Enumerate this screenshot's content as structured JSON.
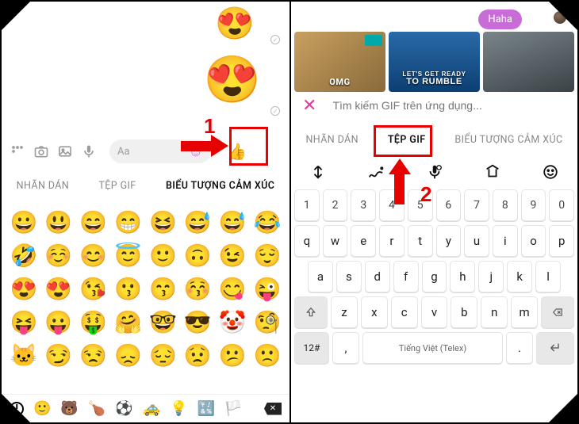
{
  "left": {
    "sent_emoji_1": "😍",
    "sent_emoji_2": "😍",
    "composer_placeholder": "Aa",
    "tabs": {
      "stickers": "NHÃN DÁN",
      "gif": "TỆP GIF",
      "emoji": "BIỂU TƯỢNG CẢM XÚC"
    },
    "emoji_grid": [
      [
        "😀",
        "😃",
        "😄",
        "😁",
        "😆",
        "😅",
        "😅",
        "😂"
      ],
      [
        "🤣",
        "☺️",
        "😊",
        "😇",
        "🙂",
        "🙃",
        "😉",
        "😌"
      ],
      [
        "😍",
        "😍",
        "😘",
        "😗",
        "😙",
        "😚",
        "😋",
        "😜"
      ],
      [
        "😝",
        "😛",
        "🤑",
        "🤗",
        "🤓",
        "😎",
        "🤡",
        "🧐"
      ],
      [
        "🐱",
        "😏",
        "😒",
        "😞",
        "😔",
        "😟",
        "😕",
        "🙁"
      ]
    ],
    "categories": [
      "🙂",
      "🐻",
      "🍗",
      "⚽",
      "🚕",
      "💡",
      "🔣",
      "🏳️"
    ]
  },
  "right": {
    "reaction": "Haha",
    "gif_labels": {
      "omg": "OMG",
      "rumble_1": "LET'S GET READY",
      "rumble_2": "TO RUMBLE"
    },
    "search_placeholder": "Tìm kiếm GIF trên ứng dụng...",
    "tabs": {
      "stickers": "NHÃN DÁN",
      "gif": "TỆP GIF",
      "emoji": "BIỂU TƯỢNG CẢM XÚC"
    },
    "kb": {
      "row_num": [
        "1",
        "2",
        "3",
        "4",
        "5",
        "6",
        "7",
        "8",
        "9",
        "0"
      ],
      "row_q": [
        "q",
        "w",
        "e",
        "r",
        "t",
        "y",
        "u",
        "i",
        "o",
        "p"
      ],
      "row_a": [
        "a",
        "s",
        "d",
        "f",
        "g",
        "h",
        "j",
        "k",
        "l"
      ],
      "row_z": [
        "z",
        "x",
        "c",
        "v",
        "b",
        "n",
        "m"
      ],
      "sym": "12#",
      "space": "Tiếng Việt (Telex)",
      "comma": ",",
      "dot": "."
    }
  },
  "annotations": {
    "one": "1",
    "two": "2"
  }
}
